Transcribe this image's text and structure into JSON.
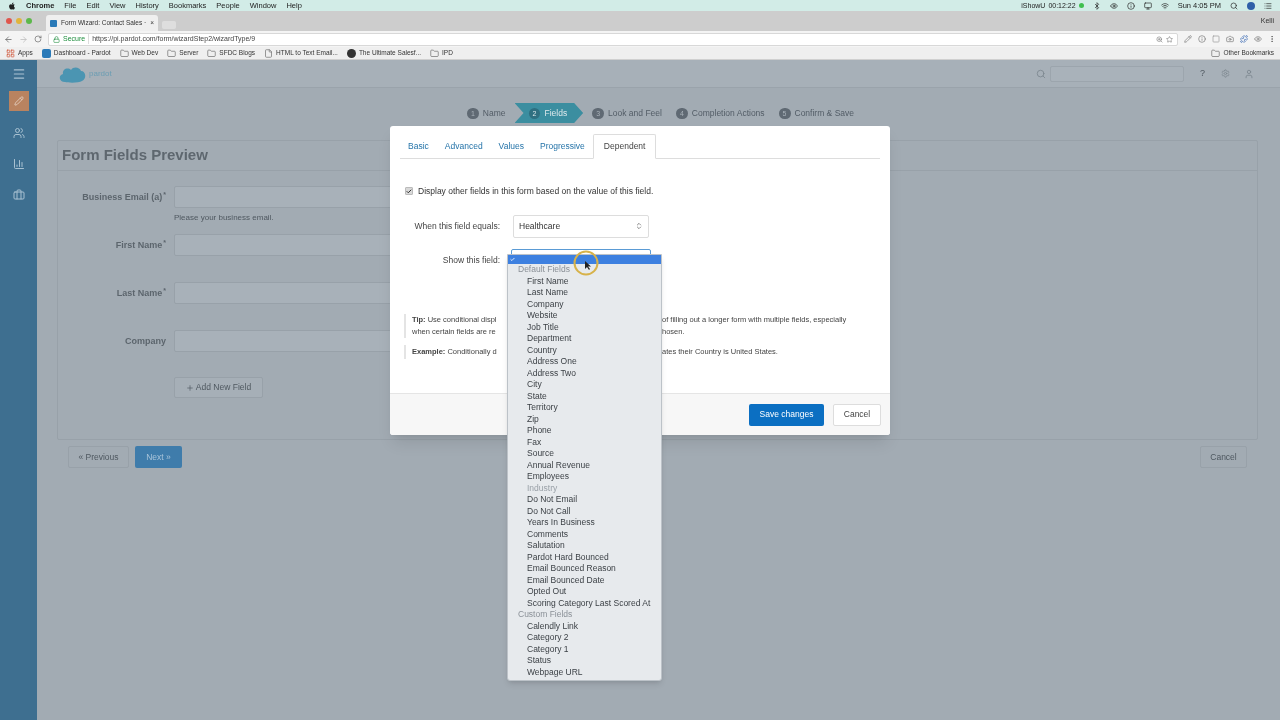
{
  "menu_bar": {
    "app": "Chrome",
    "menus": [
      "File",
      "Edit",
      "View",
      "History",
      "Bookmarks",
      "People",
      "Window",
      "Help"
    ],
    "recorder": [
      "iShowU",
      "00:12:22"
    ],
    "clock": "Sun 4:05 PM"
  },
  "browser": {
    "tab": {
      "title": "Form Wizard: Contact Sales ·",
      "close": "×"
    },
    "profile": "Kelli",
    "address": {
      "secure": "Secure",
      "url": "https://pi.pardot.com/form/wizardStep2/wizardType/9"
    },
    "bookmarks": [
      {
        "label": "Apps",
        "kind": "apps"
      },
      {
        "label": "Dashboard - Pardot",
        "kind": "favicon"
      },
      {
        "label": "Web Dev",
        "kind": "folder"
      },
      {
        "label": "Server",
        "kind": "folder"
      },
      {
        "label": "SFDC Blogs",
        "kind": "folder"
      },
      {
        "label": "HTML to Text Email...",
        "kind": "page"
      },
      {
        "label": "The Ultimate Salesf...",
        "kind": "circle"
      },
      {
        "label": "IPD",
        "kind": "folder"
      }
    ],
    "other_bookmarks": "Other Bookmarks"
  },
  "app": {
    "logo_text": "pardot",
    "help": "?",
    "required_mark": "*",
    "wizard_steps": [
      {
        "number": "1",
        "label": "Name",
        "selected": false
      },
      {
        "number": "2",
        "label": "Fields",
        "selected": true
      },
      {
        "number": "3",
        "label": "Look and Feel",
        "selected": false
      },
      {
        "number": "4",
        "label": "Completion Actions",
        "selected": false
      },
      {
        "number": "5",
        "label": "Confirm & Save",
        "selected": false
      }
    ],
    "preview": {
      "title": "Form Fields Preview",
      "fields": [
        {
          "label": "Business Email (a)",
          "required": true,
          "hint": "Please your business email."
        },
        {
          "label": "First Name",
          "required": true
        },
        {
          "label": "Last Name",
          "required": true
        },
        {
          "label": "Company",
          "required": false
        }
      ],
      "add_button": "Add New Field"
    },
    "nav": {
      "previous": "« Previous",
      "next": "Next »",
      "cancel": "Cancel"
    }
  },
  "dialog": {
    "tabs": [
      {
        "label": "Basic",
        "selected": false
      },
      {
        "label": "Advanced",
        "selected": false
      },
      {
        "label": "Values",
        "selected": false
      },
      {
        "label": "Progressive",
        "selected": false
      },
      {
        "label": "Dependent",
        "selected": true
      }
    ],
    "display_checkbox": {
      "label": "Display other fields in this form based on the value of this field.",
      "checked": true
    },
    "equals": {
      "label": "When this field equals:",
      "value": "Healthcare"
    },
    "show": {
      "label": "Show this field:"
    },
    "tip": [
      {
        "left": "**Tip:** Use conditional displ",
        "right": "of filling out a longer form with multiple fields, especially"
      },
      {
        "left": "when certain fields are re",
        "right": "hosen."
      }
    ],
    "example": {
      "left": "**Example:** Conditionally d",
      "right": "ates their Country is United States."
    },
    "buttons": {
      "save": "Save changes",
      "cancel": "Cancel"
    }
  },
  "dropdown": {
    "blank": {
      "selected": true
    },
    "groups": [
      {
        "label": "Default Fields",
        "options": [
          {
            "label": "First Name",
            "selected": false,
            "disabled": false
          },
          {
            "label": "Last Name",
            "selected": false,
            "disabled": false
          },
          {
            "label": "Company",
            "selected": false,
            "disabled": false
          },
          {
            "label": "Website",
            "selected": false,
            "disabled": false
          },
          {
            "label": "Job Title",
            "selected": false,
            "disabled": false
          },
          {
            "label": "Department",
            "selected": false,
            "disabled": false
          },
          {
            "label": "Country",
            "selected": false,
            "disabled": false
          },
          {
            "label": "Address One",
            "selected": false,
            "disabled": false
          },
          {
            "label": "Address Two",
            "selected": false,
            "disabled": false
          },
          {
            "label": "City",
            "selected": false,
            "disabled": false
          },
          {
            "label": "State",
            "selected": false,
            "disabled": false
          },
          {
            "label": "Territory",
            "selected": false,
            "disabled": false
          },
          {
            "label": "Zip",
            "selected": false,
            "disabled": false
          },
          {
            "label": "Phone",
            "selected": false,
            "disabled": false
          },
          {
            "label": "Fax",
            "selected": false,
            "disabled": false
          },
          {
            "label": "Source",
            "selected": false,
            "disabled": false
          },
          {
            "label": "Annual Revenue",
            "selected": false,
            "disabled": false
          },
          {
            "label": "Employees",
            "selected": false,
            "disabled": false
          },
          {
            "label": "Industry",
            "selected": false,
            "disabled": true
          },
          {
            "label": "Do Not Email",
            "selected": false,
            "disabled": false
          },
          {
            "label": "Do Not Call",
            "selected": false,
            "disabled": false
          },
          {
            "label": "Years In Business",
            "selected": false,
            "disabled": false
          },
          {
            "label": "Comments",
            "selected": false,
            "disabled": false
          },
          {
            "label": "Salutation",
            "selected": false,
            "disabled": false
          },
          {
            "label": "Pardot Hard Bounced",
            "selected": false,
            "disabled": false
          },
          {
            "label": "Email Bounced Reason",
            "selected": false,
            "disabled": false
          },
          {
            "label": "Email Bounced Date",
            "selected": false,
            "disabled": false
          },
          {
            "label": "Opted Out",
            "selected": false,
            "disabled": false
          },
          {
            "label": "Scoring Category Last Scored At",
            "selected": false,
            "disabled": false
          }
        ]
      },
      {
        "label": "Custom Fields",
        "options": [
          {
            "label": "Calendly Link",
            "selected": false,
            "disabled": false
          },
          {
            "label": "Category 2",
            "selected": false,
            "disabled": false
          },
          {
            "label": "Category 1",
            "selected": false,
            "disabled": false
          },
          {
            "label": "Status",
            "selected": false,
            "disabled": false
          },
          {
            "label": "Webpage URL",
            "selected": false,
            "disabled": false
          }
        ]
      }
    ]
  }
}
